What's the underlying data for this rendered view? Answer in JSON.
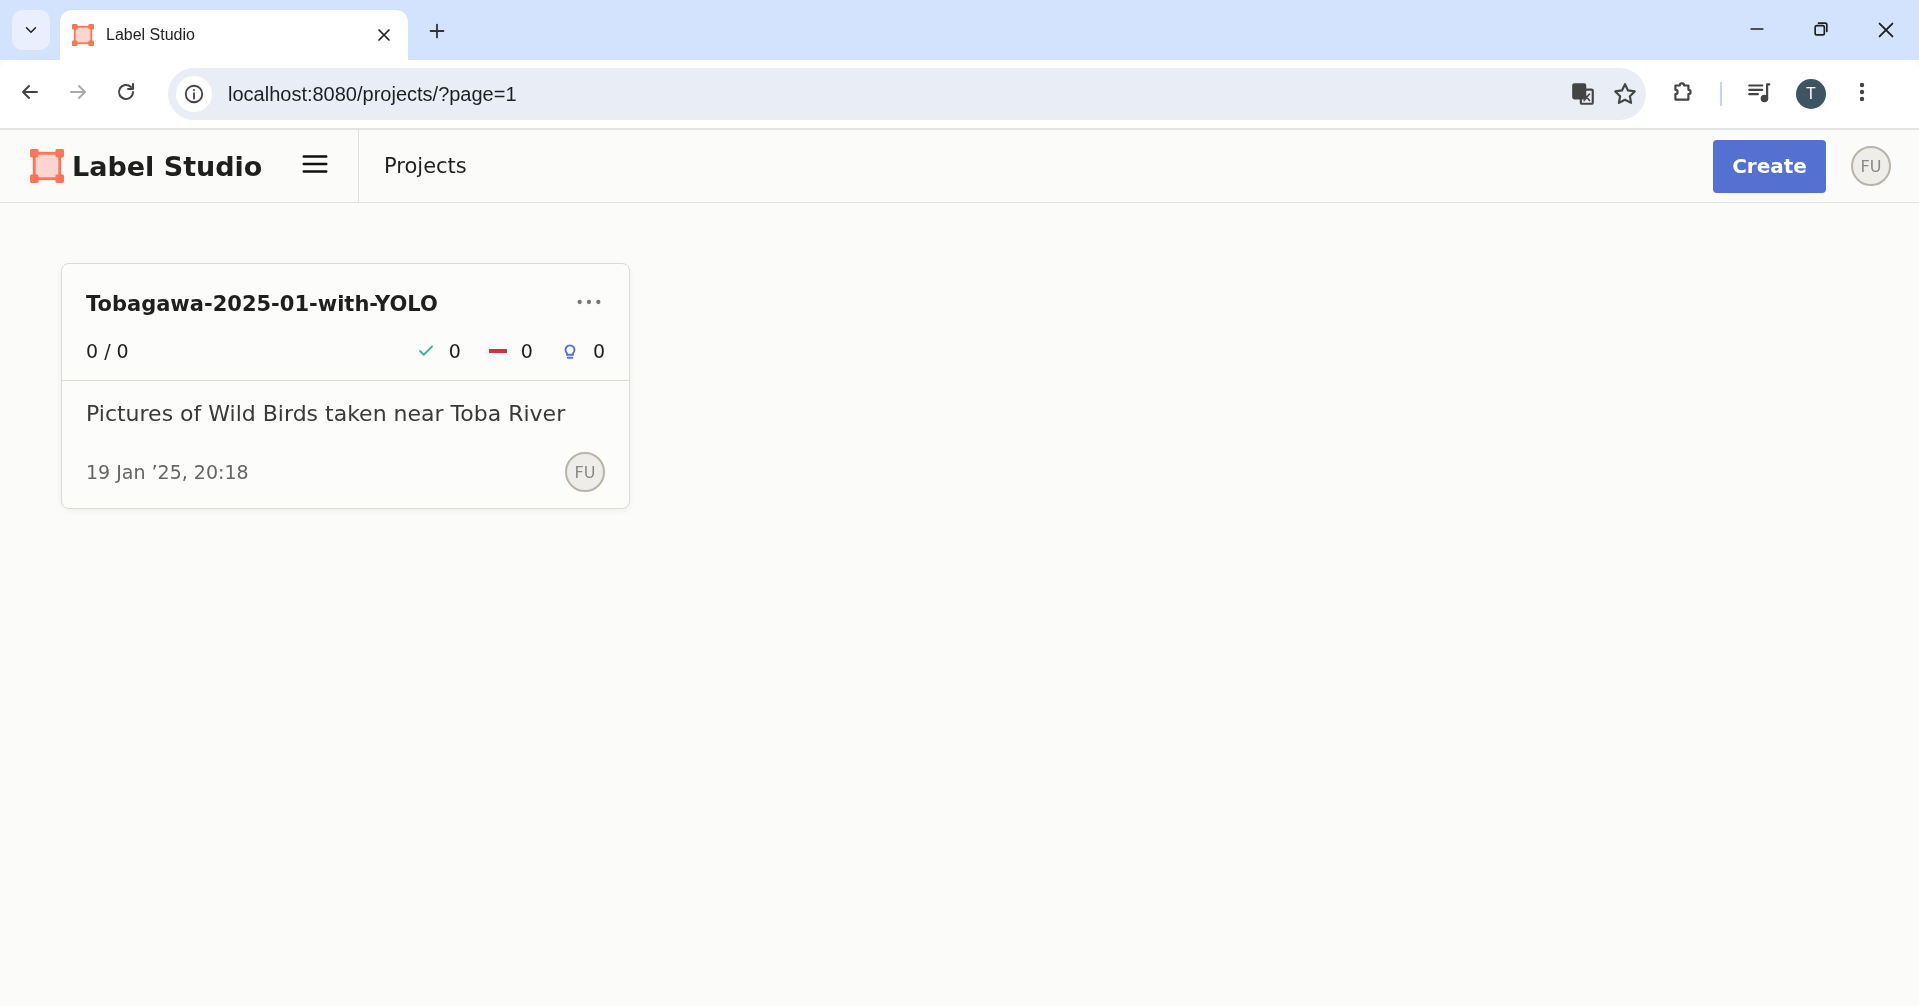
{
  "browser": {
    "tabs": [
      {
        "title": "Label Studio",
        "selected": true
      }
    ],
    "address": "localhost:8080/projects/?page=1",
    "profile_initial": "T"
  },
  "app": {
    "brand": "Label Studio",
    "page_title": "Projects",
    "create_button": "Create",
    "user_initials": "FU"
  },
  "projects": [
    {
      "title": "Tobagawa-2025-01-with-YOLO",
      "progress": "0 / 0",
      "completed": "0",
      "skipped": "0",
      "predictions": "0",
      "description": "Pictures of Wild Birds taken near Toba River",
      "created": "19 Jan ’25, 20:18",
      "owner_initials": "FU"
    }
  ]
}
